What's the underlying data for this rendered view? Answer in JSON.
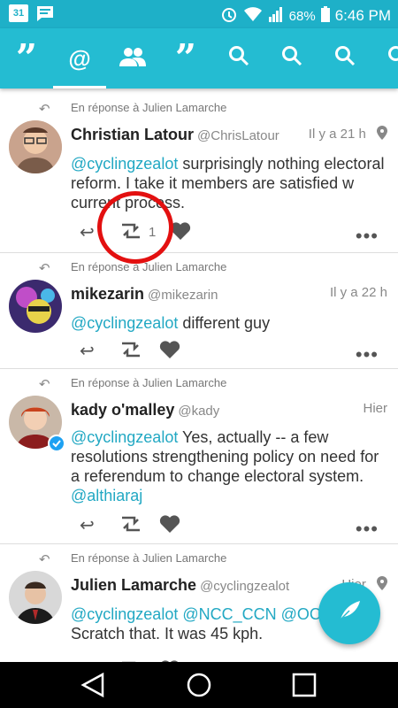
{
  "status_bar": {
    "battery": "68%",
    "time": "6:46 PM",
    "notif_icons": [
      "calendar-icon",
      "message-icon"
    ],
    "calendar_day": "31"
  },
  "tabs": [
    {
      "icon": "quote-icon",
      "label": "”"
    },
    {
      "icon": "mention-icon",
      "label": "@",
      "active": true
    },
    {
      "icon": "people-icon",
      "label": ""
    },
    {
      "icon": "quote-icon",
      "label": "”"
    },
    {
      "icon": "search-icon",
      "label": ""
    },
    {
      "icon": "search-icon",
      "label": ""
    },
    {
      "icon": "search-icon",
      "label": ""
    },
    {
      "icon": "search-icon",
      "label": ""
    }
  ],
  "tweets": [
    {
      "reply_to": "En réponse à Julien Lamarche",
      "name": "Christian Latour",
      "handle": "@ChrisLatour",
      "time": "Il y a 21 h",
      "has_location": true,
      "mention": "@cyclingzealot",
      "text": " surprisingly nothing electoral reform. I take it members are satisfied w current process.",
      "retweet_count": "1"
    },
    {
      "reply_to": "En réponse à Julien Lamarche",
      "name": "mikezarin",
      "handle": "@mikezarin",
      "time": "Il y a 22 h",
      "mention": "@cyclingzealot",
      "text": " different guy",
      "retweet_count": ""
    },
    {
      "reply_to": "En réponse à Julien Lamarche",
      "name": "kady o'malley",
      "handle": "@kady",
      "time": "Hier",
      "mention": "@cyclingzealot",
      "text": " Yes, actually -- a few resolutions strengthening policy on need for a referendum to change electoral system.",
      "trailing_mention": "@althiaraj",
      "retweet_count": ""
    },
    {
      "reply_to": "En réponse à Julien Lamarche",
      "name": "Julien Lamarche",
      "handle": "@cyclingzealot",
      "time": "Hier",
      "has_location": true,
      "mention": "@cyclingzealot @NCC_CCN @OC_",
      "text": " Scratch that.  It was 45 kph.",
      "retweet_count": ""
    }
  ],
  "action_icons": {
    "reply": "reply-icon",
    "retweet": "retweet-icon",
    "like": "heart-icon",
    "more": "more-icon"
  },
  "annotation_color": "#e31010",
  "accent": "#24bcd2"
}
